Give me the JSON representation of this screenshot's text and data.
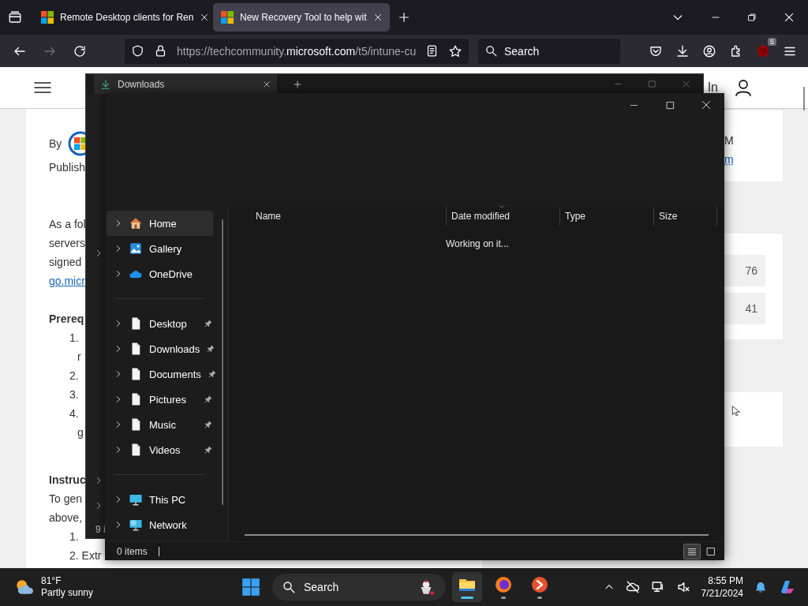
{
  "browser": {
    "tabs": [
      {
        "title": "Remote Desktop clients for Ren",
        "selected": false
      },
      {
        "title": "New Recovery Tool to help wit",
        "selected": true
      }
    ],
    "forward_disabled": true,
    "url": "https://techcommunity.**microsoft.com**/t5/intune-cu",
    "search_placeholder": "Search",
    "badge": "5"
  },
  "webpage": {
    "header_link": "In",
    "sections": [
      {
        "kind": "byline",
        "lines": [
          {
            "kind": "author",
            "text": "By"
          },
          {
            "kind": "text",
            "text": "Publish"
          }
        ]
      },
      {
        "kind": "paragraph",
        "lines": [
          {
            "kind": "text",
            "text": "As a fol"
          },
          {
            "kind": "text",
            "text": "servers"
          },
          {
            "kind": "text",
            "text": "signed"
          },
          {
            "kind": "link",
            "text": "go.micr"
          }
        ]
      },
      {
        "kind": "paragraph",
        "lines": [
          {
            "kind": "heading",
            "text": "Prereq"
          },
          {
            "kind": "item",
            "number": "1."
          },
          {
            "kind": "cont",
            "text": "r"
          },
          {
            "kind": "item",
            "number": "2."
          },
          {
            "kind": "item",
            "number": "3."
          },
          {
            "kind": "item",
            "number": "4."
          },
          {
            "kind": "cont",
            "text": "g"
          }
        ]
      },
      {
        "kind": "paragraph",
        "lines": [
          {
            "kind": "heading",
            "text": "Instruc"
          },
          {
            "kind": "text",
            "text": "To gen"
          },
          {
            "kind": "text",
            "text": "above,"
          },
          {
            "kind": "item",
            "number": "1."
          },
          {
            "kind": "item",
            "number": "2.",
            "text": "Extr",
            "link": false
          }
        ]
      }
    ],
    "side": {
      "text": "M",
      "link": "m",
      "stats": [
        "76",
        "41"
      ]
    }
  },
  "back_window": {
    "tab": "Downloads",
    "count": "9 i"
  },
  "explorer": {
    "columns": [
      {
        "label": "Name",
        "sorted": false
      },
      {
        "label": "Date modified",
        "sorted": true
      },
      {
        "label": "Type",
        "sorted": false
      },
      {
        "label": "Size",
        "sorted": false
      }
    ],
    "message": "Working on it...",
    "groups": [
      {
        "items": [
          {
            "label": "Home",
            "selected": true,
            "pinned": false
          },
          {
            "label": "Gallery",
            "selected": false,
            "pinned": false
          },
          {
            "label": "OneDrive",
            "selected": false,
            "pinned": false
          }
        ]
      },
      {
        "items": [
          {
            "label": "Desktop",
            "selected": false,
            "pinned": true
          },
          {
            "label": "Downloads",
            "selected": false,
            "pinned": true
          },
          {
            "label": "Documents",
            "selected": false,
            "pinned": true
          },
          {
            "label": "Pictures",
            "selected": false,
            "pinned": true
          },
          {
            "label": "Music",
            "selected": false,
            "pinned": true
          },
          {
            "label": "Videos",
            "selected": false,
            "pinned": true
          }
        ]
      },
      {
        "items": [
          {
            "label": "This PC",
            "selected": false,
            "pinned": false
          },
          {
            "label": "Network",
            "selected": false,
            "pinned": false
          }
        ]
      }
    ],
    "status": "0 items",
    "views": [
      {
        "selected": true
      },
      {
        "selected": false
      }
    ]
  },
  "taskbar": {
    "temp": "81°F",
    "condition": "Partly sunny",
    "search_placeholder": "Search",
    "apps": [
      {
        "active": true
      },
      {
        "active": false
      },
      {
        "active": false
      }
    ],
    "time": "8:55 PM",
    "date": "7/21/2024"
  }
}
